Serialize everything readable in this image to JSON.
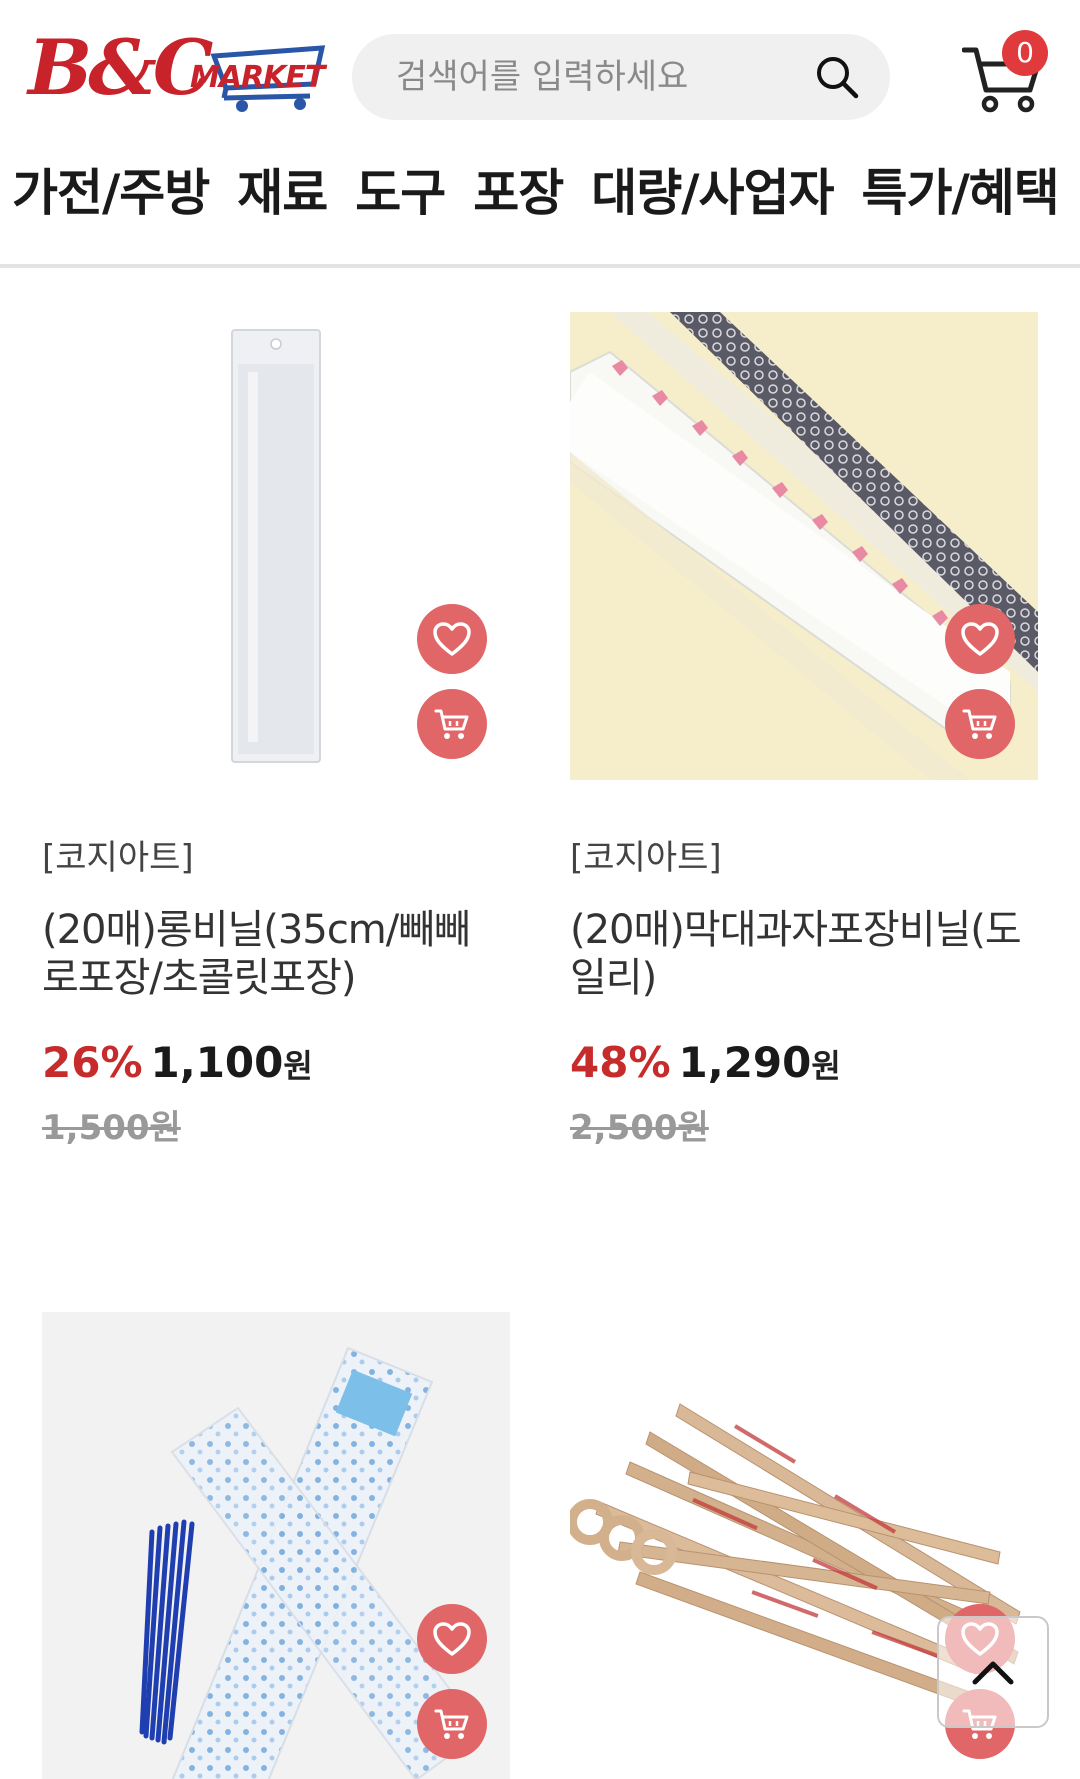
{
  "header": {
    "logo_main": "B&C",
    "logo_sub": "MARKET",
    "search_placeholder": "검색어를 입력하세요",
    "cart_count": "0"
  },
  "nav": {
    "items": [
      "가전/주방",
      "재료",
      "도구",
      "포장",
      "대량/사업자",
      "특가/혜택"
    ]
  },
  "products": [
    {
      "brand": "[코지아트]",
      "name": "(20매)롱비닐(35cm/빼빼로포장/초콜릿포장)",
      "discount": "26%",
      "price": "1,100",
      "price_unit": "원",
      "original_price": "1,500원"
    },
    {
      "brand": "[코지아트]",
      "name": "(20매)막대과자포장비닐(도일리)",
      "discount": "48%",
      "price": "1,290",
      "price_unit": "원",
      "original_price": "2,500원"
    },
    {},
    {}
  ],
  "colors": {
    "brand_red": "#c8222b",
    "discount_red": "#c62c2c",
    "fab_pink": "#e06668",
    "logo_blue": "#2a56a8"
  },
  "icons": {
    "wishlist": "heart-icon",
    "add_to_cart": "cart-icon",
    "search": "search-icon",
    "scroll_top": "chevron-up-icon"
  }
}
